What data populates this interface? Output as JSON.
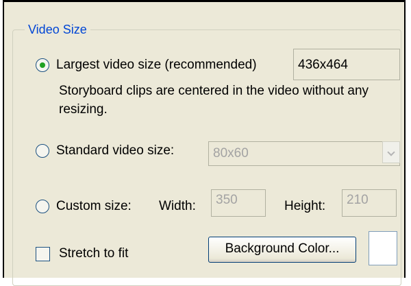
{
  "group": {
    "title": "Video Size"
  },
  "largest": {
    "label": "Largest video size (recommended)",
    "value": "436x464",
    "description": "Storyboard clips are centered in the video without any resizing.",
    "selected": true
  },
  "standard": {
    "label": "Standard video size:",
    "selected_option": "80x60",
    "selected": false
  },
  "custom": {
    "label": "Custom size:",
    "width_label": "Width:",
    "width_value": "350",
    "height_label": "Height:",
    "height_value": "210",
    "selected": false
  },
  "stretch": {
    "label": "Stretch to fit",
    "checked": false
  },
  "background_button": {
    "label": "Background Color..."
  },
  "background_color": "#ffffff"
}
